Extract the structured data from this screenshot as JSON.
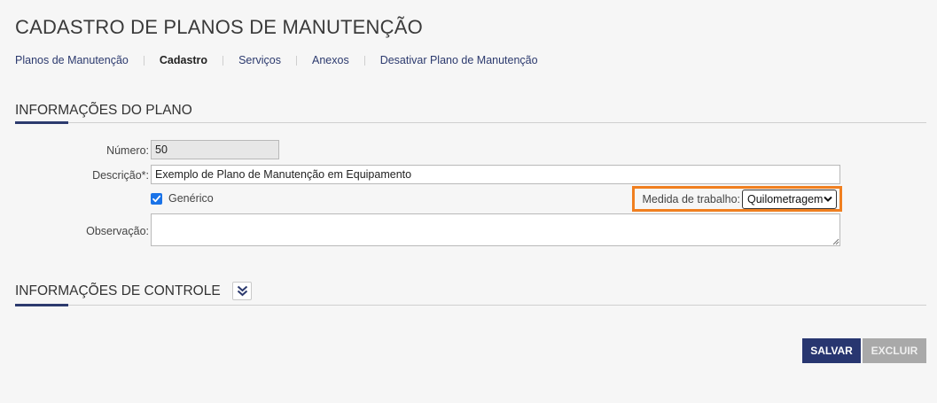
{
  "page": {
    "title": "CADASTRO DE PLANOS DE MANUTENÇÃO"
  },
  "nav": {
    "items": [
      {
        "label": "Planos de Manutenção",
        "active": false
      },
      {
        "label": "Cadastro",
        "active": true
      },
      {
        "label": "Serviços",
        "active": false
      },
      {
        "label": "Anexos",
        "active": false
      },
      {
        "label": "Desativar Plano de Manutenção",
        "active": false
      }
    ]
  },
  "section_plan": {
    "title": "INFORMAÇÕES DO PLANO",
    "numero_label": "Número:",
    "numero_value": "50",
    "descricao_label": "Descrição*:",
    "descricao_value": "Exemplo de Plano de Manutenção em Equipamento",
    "generico_label": "Genérico",
    "generico_checked": true,
    "medida_label": "Medida de trabalho:",
    "medida_value": "Quilometragem",
    "observacao_label": "Observação:",
    "observacao_value": ""
  },
  "section_control": {
    "title": "INFORMAÇÕES DE CONTROLE",
    "expand_icon": "double-chevron-down-icon"
  },
  "actions": {
    "save_label": "SALVAR",
    "delete_label": "EXCLUIR"
  },
  "colors": {
    "brand": "#2c3a6e",
    "highlight": "#f07f1f",
    "checkbox": "#1a73e8",
    "disabled": "#a9a9a9"
  }
}
